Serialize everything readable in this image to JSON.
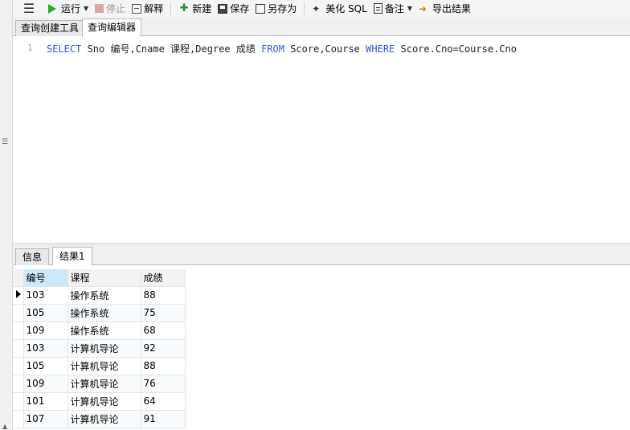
{
  "toolbar": {
    "run": "运行",
    "stop": "停止",
    "explain": "解释",
    "new": "新建",
    "save": "保存",
    "save_as": "另存为",
    "beautify": "美化 SQL",
    "note": "备注",
    "export": "导出结果"
  },
  "editor_tabs": [
    "查询创建工具",
    "查询编辑器"
  ],
  "editor": {
    "line_number": "1",
    "tokens": [
      {
        "t": "SELECT",
        "kw": true
      },
      {
        "t": " Sno 编号,Cname 课程,Degree 成绩 ",
        "kw": false
      },
      {
        "t": "FROM",
        "kw": true
      },
      {
        "t": " Score,Course ",
        "kw": false
      },
      {
        "t": "WHERE",
        "kw": true
      },
      {
        "t": " Score.Cno=Course.Cno",
        "kw": false
      }
    ]
  },
  "result_tabs": [
    "信息",
    "结果1"
  ],
  "grid": {
    "columns": [
      "编号",
      "课程",
      "成绩"
    ],
    "rows": [
      [
        "103",
        "操作系统",
        "88"
      ],
      [
        "105",
        "操作系统",
        "75"
      ],
      [
        "109",
        "操作系统",
        "68"
      ],
      [
        "103",
        "计算机导论",
        "92"
      ],
      [
        "105",
        "计算机导论",
        "88"
      ],
      [
        "109",
        "计算机导论",
        "76"
      ],
      [
        "101",
        "计算机导论",
        "64"
      ],
      [
        "107",
        "计算机导论",
        "91"
      ]
    ]
  },
  "colors": {
    "keyword": "#3b54d6",
    "run_icon": "#2fa83a",
    "selected_header": "#cde8f8"
  },
  "icons": {
    "menu": "hamburger-icon",
    "run": "play-icon",
    "stop": "stop-icon",
    "explain": "explain-icon",
    "new": "new-query-icon",
    "save": "floppy-icon",
    "save_as": "save-as-icon",
    "beautify": "magic-wand-icon",
    "note": "note-icon",
    "export": "export-icon"
  }
}
